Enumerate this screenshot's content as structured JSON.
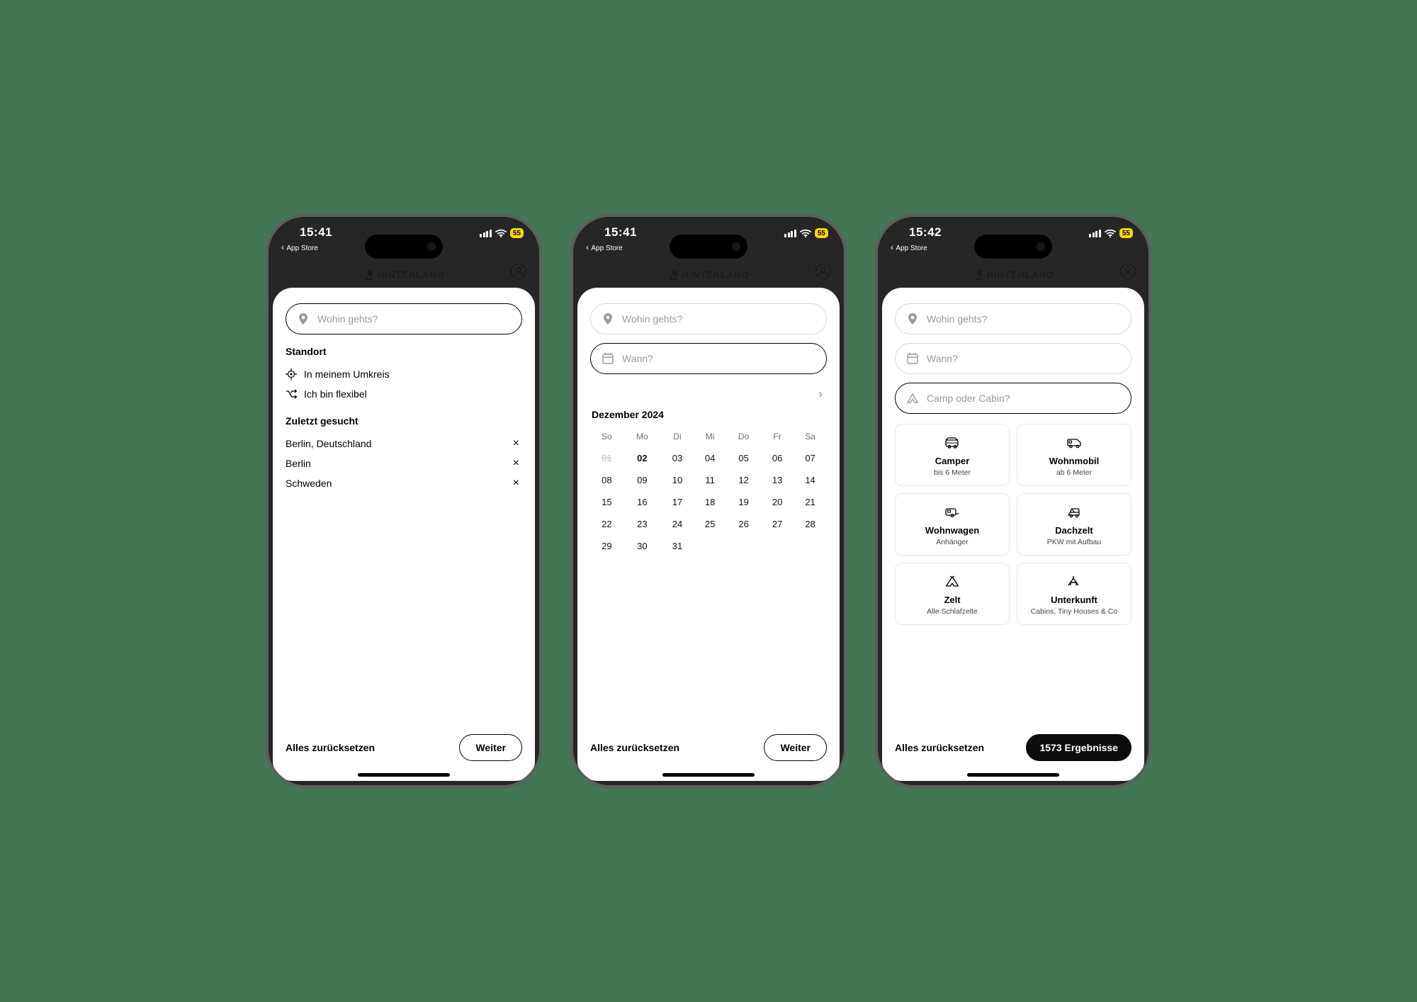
{
  "status": {
    "back": "App Store",
    "battery": "55"
  },
  "times": {
    "p1": "15:41",
    "p2": "15:41",
    "p3": "15:42"
  },
  "brand": "HINTERLAND",
  "reset": "Alles zurücksetzen",
  "next": "Weiter",
  "search_placeholder": "Wohin gehts?",
  "when_placeholder": "Wann?",
  "type_placeholder": "Camp oder Cabin?",
  "p1": {
    "loc_heading": "Standort",
    "nearme": "In meinem Umkreis",
    "flexible": "Ich bin flexibel",
    "recent_heading": "Zuletzt gesucht",
    "recent": [
      "Berlin, Deutschland",
      "Berlin",
      "Schweden"
    ]
  },
  "p2": {
    "month": "Dezember 2024",
    "weekdays": [
      "So",
      "Mo",
      "Di",
      "Mi",
      "Do",
      "Fr",
      "Sa"
    ],
    "rows": [
      [
        "01",
        "02",
        "03",
        "04",
        "05",
        "06",
        "07"
      ],
      [
        "08",
        "09",
        "10",
        "11",
        "12",
        "13",
        "14"
      ],
      [
        "15",
        "16",
        "17",
        "18",
        "19",
        "20",
        "21"
      ],
      [
        "22",
        "23",
        "24",
        "25",
        "26",
        "27",
        "28"
      ],
      [
        "29",
        "30",
        "31",
        "",
        "",
        "",
        ""
      ]
    ],
    "past": "01",
    "today": "02"
  },
  "p3": {
    "results": "1573 Ergebnisse",
    "cards": [
      {
        "t": "Camper",
        "s": "bis 6 Meter"
      },
      {
        "t": "Wohnmobil",
        "s": "ab 6 Meter"
      },
      {
        "t": "Wohnwagen",
        "s": "Anhänger"
      },
      {
        "t": "Dachzelt",
        "s": "PKW mit Aufbau"
      },
      {
        "t": "Zelt",
        "s": "Alle Schlafzelte"
      },
      {
        "t": "Unterkunft",
        "s": "Cabins, Tiny Houses & Co"
      }
    ]
  }
}
